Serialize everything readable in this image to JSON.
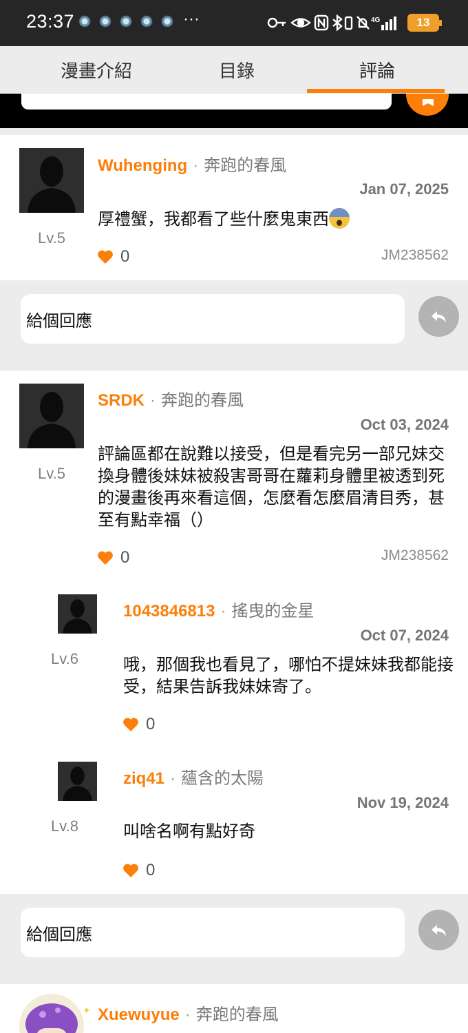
{
  "status_bar": {
    "time": "23:37",
    "more": "···",
    "battery": "13",
    "icons": [
      "key-icon",
      "eye-icon",
      "nfc-icon",
      "bluetooth-icon",
      "vibrate-icon",
      "mute-icon",
      "4g-signal-icon"
    ]
  },
  "tabs": [
    {
      "label": "漫畫介紹"
    },
    {
      "label": "目錄"
    },
    {
      "label": "評論"
    }
  ],
  "accent_color": "#fb7f09",
  "comments": [
    {
      "username": "Wuhenging",
      "separator": "·",
      "rank": "奔跑的春風",
      "level": "Lv.5",
      "date": "Jan 07, 2025",
      "text": "厚禮蟹，我都看了些什麼鬼東西",
      "emoji": "fearful-face",
      "likes": "0",
      "code": "JM238562"
    },
    {
      "username": "SRDK",
      "separator": "·",
      "rank": "奔跑的春風",
      "level": "Lv.5",
      "date": "Oct 03, 2024",
      "text": "評論區都在說難以接受，但是看完另一部兄妹交換身體後妹妹被殺害哥哥在蘿莉身體里被透到死的漫畫後再來看這個，怎麼看怎麼眉清目秀，甚至有點幸福（）",
      "likes": "0",
      "code": "JM238562",
      "replies": [
        {
          "username": "1043846813",
          "separator": "·",
          "rank": "搖曳的金星",
          "level": "Lv.6",
          "date": "Oct 07, 2024",
          "text": "哦，那個我也看見了，哪怕不提妹妹我都能接受，結果告訴我妹妹寄了。",
          "likes": "0"
        },
        {
          "username": "ziq41",
          "separator": "·",
          "rank": "蘊含的太陽",
          "level": "Lv.8",
          "date": "Nov 19, 2024",
          "text": "叫啥名啊有點好奇",
          "likes": "0"
        }
      ]
    },
    {
      "username": "Xuewuyue",
      "separator": "·",
      "rank": "奔跑的春風"
    }
  ],
  "reply_box": {
    "placeholder": "給個回應"
  }
}
